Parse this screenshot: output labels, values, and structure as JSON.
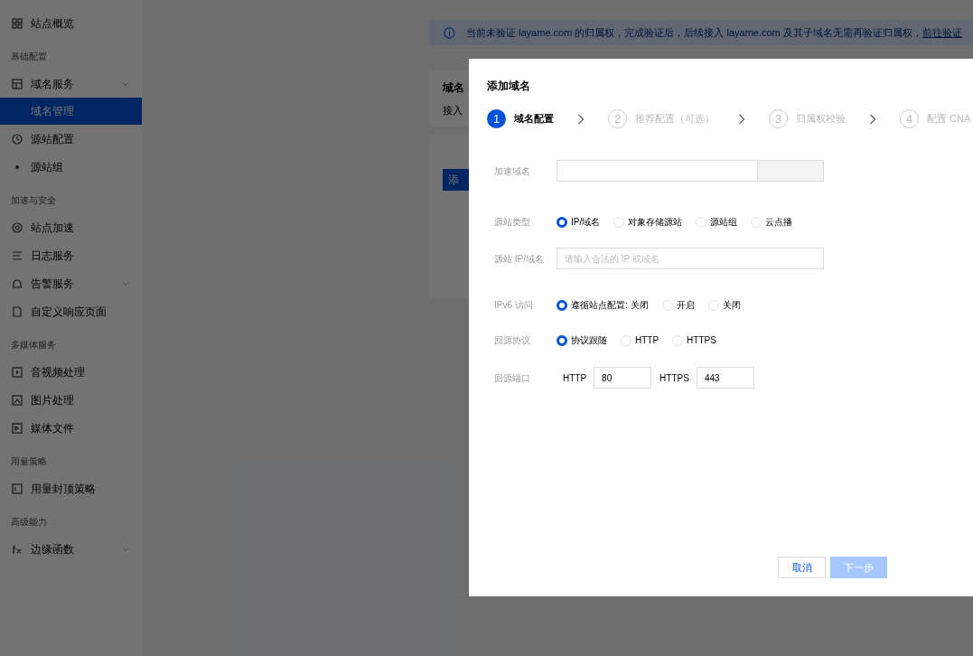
{
  "sidebar": {
    "sections": [
      {
        "items": [
          {
            "label": "站点概览",
            "selected": false,
            "expandable": false
          }
        ]
      },
      {
        "title": "基础配置",
        "items": [
          {
            "label": "域名服务",
            "selected": false,
            "expandable": true,
            "children": [
              {
                "label": "域名管理",
                "selected": true
              }
            ]
          },
          {
            "label": "源站配置",
            "selected": false,
            "expandable": false
          },
          {
            "label": "源站组",
            "selected": false,
            "expandable": false
          }
        ]
      },
      {
        "title": "加速与安全",
        "items": [
          {
            "label": "站点加速",
            "selected": false,
            "expandable": false
          },
          {
            "label": "日志服务",
            "selected": false,
            "expandable": false
          },
          {
            "label": "告警服务",
            "selected": false,
            "expandable": true
          },
          {
            "label": "自定义响应页面",
            "selected": false,
            "expandable": false
          }
        ]
      },
      {
        "title": "多媒体服务",
        "items": [
          {
            "label": "音视频处理",
            "selected": false,
            "expandable": false
          },
          {
            "label": "图片处理",
            "selected": false,
            "expandable": false
          },
          {
            "label": "媒体文件",
            "selected": false,
            "expandable": false
          }
        ]
      },
      {
        "title": "用量策略",
        "items": [
          {
            "label": "用量封顶策略",
            "selected": false,
            "expandable": false
          }
        ]
      },
      {
        "title": "高级能力",
        "items": [
          {
            "label": "边缘函数",
            "selected": false,
            "expandable": true
          }
        ]
      }
    ]
  },
  "banner": {
    "text": "当前未验证 layame.com 的归属权，完成验证后，后续接入 layame.com 及其子域名无需再验证归属权，",
    "link": "前往验证"
  },
  "background_panel": {
    "title": "域名",
    "line": "接入",
    "button": "添"
  },
  "dialog": {
    "title": "添加域名",
    "steps": [
      {
        "number": "1",
        "label": "域名配置",
        "selected": true
      },
      {
        "number": "2",
        "label": "推荐配置（可选）",
        "selected": false
      },
      {
        "number": "3",
        "label": "归属权校验",
        "selected": false
      },
      {
        "number": "4",
        "label": "配置 CNA",
        "selected": false
      }
    ],
    "fields": [
      {
        "kind": "select-input",
        "label": "加速域名"
      },
      {
        "kind": "radio",
        "label": "源站类型",
        "options": [
          {
            "label": "IP/域名",
            "selected": true
          },
          {
            "label": "对象存储源站",
            "selected": false
          },
          {
            "label": "源站组",
            "selected": false
          },
          {
            "label": "云点播",
            "selected": false
          }
        ]
      },
      {
        "kind": "input",
        "label": "源站 IP/域名",
        "placeholder": "请输入合法的 IP 或域名"
      },
      {
        "kind": "radio",
        "label": "IPv6 访问",
        "options": [
          {
            "label": "遵循站点配置: 关闭",
            "selected": true
          },
          {
            "label": "开启",
            "selected": false
          },
          {
            "label": "关闭",
            "selected": false
          }
        ]
      },
      {
        "kind": "radio",
        "label": "回源协议",
        "options": [
          {
            "label": "协议跟随",
            "selected": true
          },
          {
            "label": "HTTP",
            "selected": false
          },
          {
            "label": "HTTPS",
            "selected": false
          }
        ]
      },
      {
        "kind": "ports",
        "label": "回源端口",
        "ports": [
          {
            "label": "HTTP",
            "value": "80"
          },
          {
            "label": "HTTPS",
            "value": "443"
          }
        ]
      }
    ],
    "buttons": {
      "cancel": "取消",
      "next": {
        "label": "下一步",
        "disabled": true
      }
    }
  }
}
